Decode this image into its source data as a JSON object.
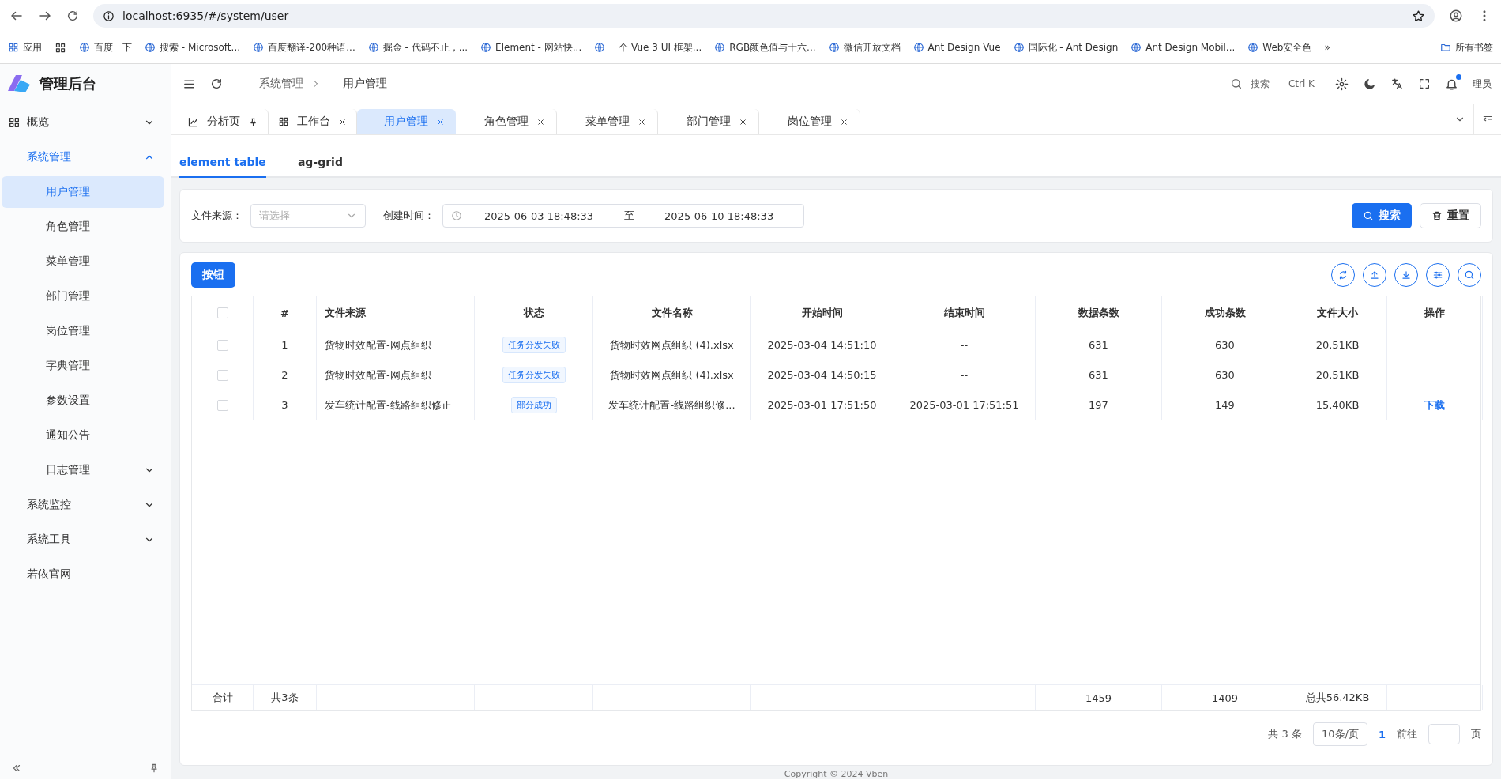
{
  "browser": {
    "url": "localhost:6935/#/system/user",
    "apps_label": "应用",
    "bookmarks": [
      {
        "label": "百度一下"
      },
      {
        "label": "搜索 - Microsoft..."
      },
      {
        "label": "百度翻译-200种语..."
      },
      {
        "label": "掘金 - 代码不止，..."
      },
      {
        "label": "Element - 网站快..."
      },
      {
        "label": "一个 Vue 3 UI 框架..."
      },
      {
        "label": "RGB颜色值与十六..."
      },
      {
        "label": "微信开放文档"
      },
      {
        "label": "Ant Design Vue"
      },
      {
        "label": "国际化 - Ant Design"
      },
      {
        "label": "Ant Design Mobil..."
      },
      {
        "label": "Web安全色"
      }
    ],
    "more": "»",
    "all_bookmarks": "所有书签"
  },
  "sidebar": {
    "logo_title": "管理后台",
    "items": [
      {
        "label": "概览",
        "kind": "submenu",
        "expanded": false,
        "selected": false
      },
      {
        "label": "系统管理",
        "kind": "submenu",
        "expanded": true,
        "selected": true,
        "children": [
          {
            "label": "用户管理",
            "kind": "link",
            "selected": true
          },
          {
            "label": "角色管理",
            "kind": "link",
            "selected": false
          },
          {
            "label": "菜单管理",
            "kind": "link",
            "selected": false
          },
          {
            "label": "部门管理",
            "kind": "link",
            "selected": false
          },
          {
            "label": "岗位管理",
            "kind": "link",
            "selected": false
          },
          {
            "label": "字典管理",
            "kind": "link",
            "selected": false
          },
          {
            "label": "参数设置",
            "kind": "link",
            "selected": false
          },
          {
            "label": "通知公告",
            "kind": "link",
            "selected": false
          },
          {
            "label": "日志管理",
            "kind": "submenu",
            "expanded": false,
            "selected": false
          }
        ]
      },
      {
        "label": "系统监控",
        "kind": "submenu",
        "expanded": false,
        "selected": false
      },
      {
        "label": "系统工具",
        "kind": "submenu",
        "expanded": false,
        "selected": false
      },
      {
        "label": "若依官网",
        "kind": "link",
        "selected": false
      }
    ]
  },
  "header": {
    "breadcrumb": [
      {
        "label": "系统管理"
      },
      {
        "label": "用户管理"
      }
    ],
    "search_label": "搜索",
    "shortcut": "Ctrl K",
    "notification_unread": true,
    "user_label": "理员"
  },
  "page_tabs": [
    {
      "label": "分析页",
      "kind": "pinned",
      "selected": false
    },
    {
      "label": "工作台",
      "kind": "closable",
      "selected": false
    },
    {
      "label": "用户管理",
      "kind": "closable",
      "selected": true
    },
    {
      "label": "角色管理",
      "kind": "closable",
      "selected": false
    },
    {
      "label": "菜单管理",
      "kind": "closable",
      "selected": false
    },
    {
      "label": "部门管理",
      "kind": "closable",
      "selected": false
    },
    {
      "label": "岗位管理",
      "kind": "closable",
      "selected": false
    }
  ],
  "content_tabs": [
    {
      "label": "element table",
      "selected": true
    },
    {
      "label": "ag-grid",
      "selected": false
    }
  ],
  "filter": {
    "source_label": "文件来源：",
    "source_placeholder": "请选择",
    "time_label": "创建时间：",
    "start": "2025-06-03 18:48:33",
    "separator": "至",
    "end": "2025-06-10 18:48:33",
    "search_button": "搜索",
    "reset_button": "重置"
  },
  "table": {
    "action_button": "按钮",
    "columns": [
      "#",
      "文件来源",
      "状态",
      "文件名称",
      "开始时间",
      "结束时间",
      "数据条数",
      "成功条数",
      "文件大小",
      "操作"
    ],
    "header_checked": false,
    "rows": [
      {
        "checked": false,
        "cells": [
          "1",
          "货物时效配置-网点组织",
          "任务分发失败",
          "货物时效网点组织 (4).xlsx",
          "2025-03-04 14:51:10",
          "--",
          "631",
          "630",
          "20.51KB"
        ]
      },
      {
        "checked": false,
        "cells": [
          "2",
          "货物时效配置-网点组织",
          "任务分发失败",
          "货物时效网点组织 (4).xlsx",
          "2025-03-04 14:50:15",
          "--",
          "631",
          "630",
          "20.51KB"
        ]
      },
      {
        "checked": false,
        "cells": [
          "3",
          "发车统计配置-线路组织修正",
          "部分成功",
          "发车统计配置-线路组织修...",
          "2025-03-01 17:51:50",
          "2025-03-01 17:51:51",
          "197",
          "149",
          "15.40KB"
        ],
        "action": "下载"
      }
    ],
    "summary": {
      "label": "合计",
      "count": "共3条",
      "data_total": "1459",
      "success_total": "1409",
      "size_total": "总共56.42KB"
    }
  },
  "pagination": {
    "total": "共 3 条",
    "page_size": "10条/页",
    "current_page": "1",
    "goto_label": "前往",
    "page_suffix": "页"
  },
  "footer": {
    "copyright": "Copyright © 2024 Vben"
  }
}
